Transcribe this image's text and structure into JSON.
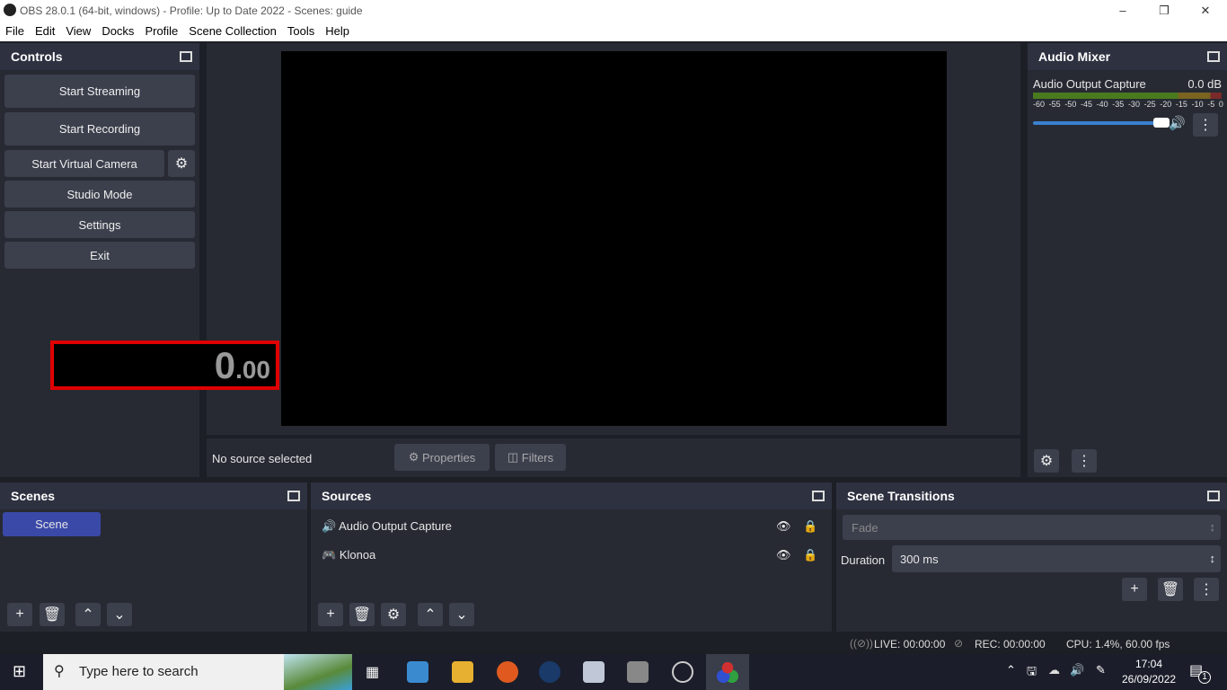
{
  "window": {
    "title": "OBS 28.0.1 (64-bit, windows) - Profile: Up to Date 2022 - Scenes: guide"
  },
  "menu": [
    "File",
    "Edit",
    "View",
    "Docks",
    "Profile",
    "Scene Collection",
    "Tools",
    "Help"
  ],
  "controls": {
    "title": "Controls",
    "start_streaming": "Start Streaming",
    "start_recording": "Start Recording",
    "start_virtual_camera": "Start Virtual Camera",
    "studio_mode": "Studio Mode",
    "settings": "Settings",
    "exit": "Exit",
    "timer_main": "0",
    "timer_frac": ".00"
  },
  "preview": {
    "no_source": "No source selected",
    "properties": "Properties",
    "filters": "Filters"
  },
  "mixer": {
    "title": "Audio Mixer",
    "channel": "Audio Output Capture",
    "level": "0.0 dB",
    "ticks": [
      "-60",
      "-55",
      "-50",
      "-45",
      "-40",
      "-35",
      "-30",
      "-25",
      "-20",
      "-15",
      "-10",
      "-5",
      "0"
    ],
    "volume_percent": 100
  },
  "scenes": {
    "title": "Scenes",
    "items": [
      "Scene"
    ]
  },
  "sources": {
    "title": "Sources",
    "items": [
      "Audio Output Capture",
      "Klonoa"
    ]
  },
  "transitions": {
    "title": "Scene Transitions",
    "selected": "Fade",
    "duration_label": "Duration",
    "duration": "300 ms"
  },
  "status": {
    "live": "LIVE: 00:00:00",
    "rec": "REC: 00:00:00",
    "cpu": "CPU: 1.4%, 60.00 fps"
  },
  "taskbar": {
    "search_placeholder": "Type here to search",
    "time": "17:04",
    "date": "26/09/2022",
    "notifications": "1"
  }
}
